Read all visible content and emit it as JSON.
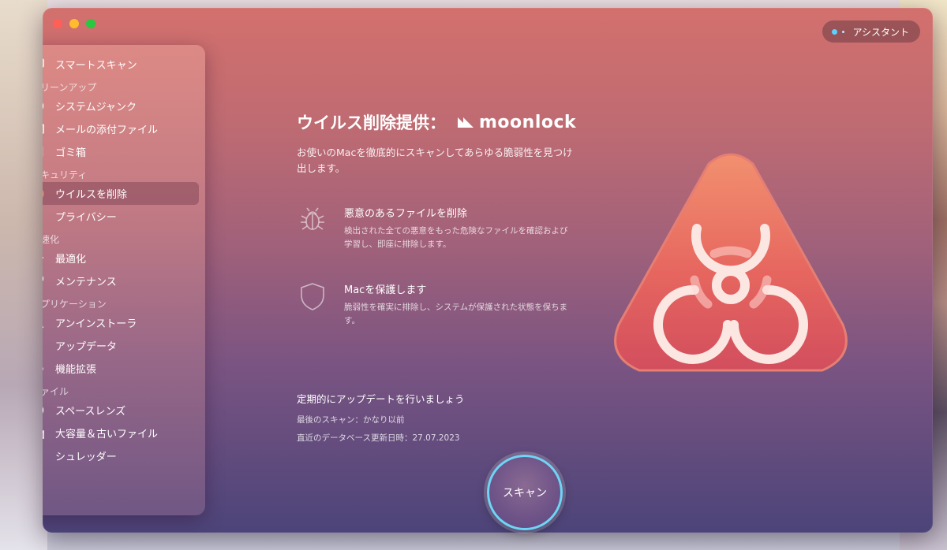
{
  "window": {
    "traffic_lights": [
      "close",
      "minimize",
      "zoom"
    ]
  },
  "assistant": {
    "label": "アシスタント",
    "dot_color": "#5ad1ff"
  },
  "sidebar": {
    "top_item": {
      "label": "スマートスキャン",
      "icon": "monitor-icon"
    },
    "sections": [
      {
        "heading": "クリーンアップ",
        "items": [
          {
            "label": "システムジャンク",
            "icon": "disk-icon"
          },
          {
            "label": "メールの添付ファイル",
            "icon": "mail-icon"
          },
          {
            "label": "ゴミ箱",
            "icon": "trash-icon"
          }
        ]
      },
      {
        "heading": "セキュリティ",
        "items": [
          {
            "label": "ウイルスを削除",
            "icon": "biohazard-icon",
            "active": true
          },
          {
            "label": "プライバシー",
            "icon": "hand-icon"
          }
        ]
      },
      {
        "heading": "高速化",
        "items": [
          {
            "label": "最適化",
            "icon": "sliders-icon"
          },
          {
            "label": "メンテナンス",
            "icon": "wrench-icon"
          }
        ]
      },
      {
        "heading": "アプリケーション",
        "items": [
          {
            "label": "アンインストーラ",
            "icon": "app-icon"
          },
          {
            "label": "アップデータ",
            "icon": "update-icon"
          },
          {
            "label": "機能拡張",
            "icon": "puzzle-icon"
          }
        ]
      },
      {
        "heading": "ファイル",
        "items": [
          {
            "label": "スペースレンズ",
            "icon": "lens-icon"
          },
          {
            "label": "大容量＆古いファイル",
            "icon": "folder-icon"
          },
          {
            "label": "シュレッダー",
            "icon": "shredder-icon"
          }
        ]
      }
    ]
  },
  "main": {
    "title": "ウイルス削除提供：",
    "brand": "moonlock",
    "description": "お使いのMacを徹底的にスキャンしてあらゆる脆弱性を見つけ出します。",
    "features": [
      {
        "icon": "bug-icon",
        "title": "悪意のあるファイルを削除",
        "text": "検出された全ての悪意をもった危険なファイルを確認および学習し、即座に排除します。"
      },
      {
        "icon": "shield-icon",
        "title": "Macを保護します",
        "text": "脆弱性を確実に排除し、システムが保護された状態を保ちます。"
      }
    ],
    "update": {
      "title": "定期的にアップデートを行いましょう",
      "last_scan": "最後のスキャン：かなり以前",
      "db_update": "直近のデータベース更新日時：27.07.2023"
    },
    "hero_icon": "biohazard-triangle-icon"
  },
  "scan_button": {
    "label": "スキャン",
    "ring_color": "#6fd4f5"
  }
}
